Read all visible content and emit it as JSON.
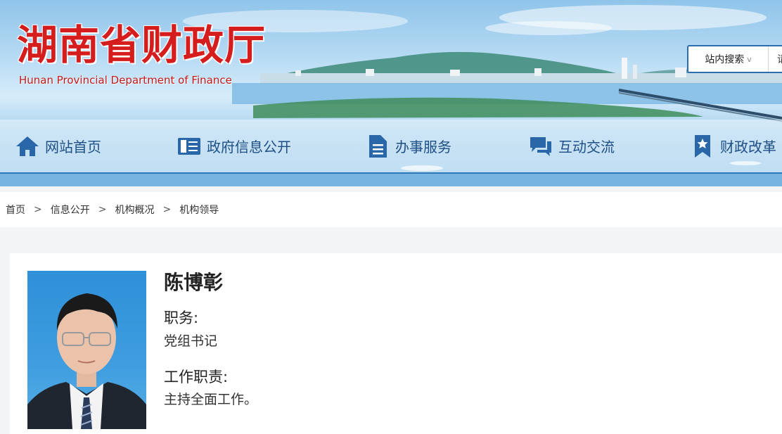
{
  "header": {
    "title": "湖南省财政厅",
    "subtitle": "Hunan Provincial Department of Finance"
  },
  "search": {
    "scope_label": "站内搜索",
    "input_value": "请"
  },
  "nav": {
    "items": [
      {
        "label": "网站首页",
        "icon": "home-icon"
      },
      {
        "label": "政府信息公开",
        "icon": "info-panel-icon"
      },
      {
        "label": "办事服务",
        "icon": "document-icon"
      },
      {
        "label": "互动交流",
        "icon": "chat-icon"
      },
      {
        "label": "财政改革",
        "icon": "bookmark-star-icon"
      }
    ]
  },
  "breadcrumb": {
    "items": [
      "首页",
      "信息公开",
      "机构概况",
      "机构领导"
    ],
    "separator": ">"
  },
  "profile": {
    "name": "陈博彰",
    "position_label": "职务:",
    "position_value": "党组书记",
    "duty_label": "工作职责:",
    "duty_value": "主持全面工作。"
  },
  "colors": {
    "title_red": "#d51d1d",
    "nav_text": "#1d4f86",
    "nav_border": "#2d76b8",
    "icon_blue": "#2a67a8"
  }
}
